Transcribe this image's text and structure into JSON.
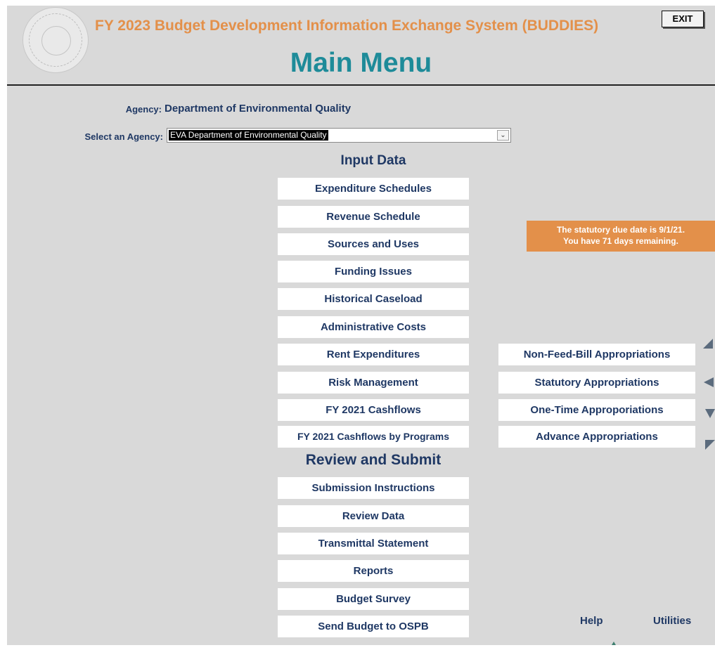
{
  "header": {
    "app_title": "FY 2023 Budget Development Information Exchange System (BUDDIES)",
    "main_title": "Main Menu",
    "exit_label": "EXIT"
  },
  "agency": {
    "label": "Agency:",
    "value": "Department of Environmental Quality",
    "select_label": "Select an Agency:",
    "select_value": "EVA Department of Environmental Quality",
    "select_arrow_icon": "chevron-down-icon"
  },
  "input_data": {
    "title": "Input Data",
    "buttons": [
      "Expenditure Schedules",
      "Revenue Schedule",
      "Sources and Uses",
      "Funding Issues",
      "Historical Caseload",
      "Administrative Costs",
      "Rent Expenditures",
      "Risk Management",
      "FY 2021 Cashflows",
      "FY 2021 Cashflows by Programs"
    ]
  },
  "review_submit": {
    "title": "Review and Submit",
    "buttons": [
      "Submission Instructions",
      "Review Data",
      "Transmittal Statement",
      "Reports",
      "Budget Survey",
      "Send Budget to OSPB"
    ]
  },
  "appropriations": {
    "buttons": [
      "Non-Feed-Bill Appropriations",
      "Statutory Appropriations",
      "One-Time Approporiations",
      "Advance Appropriations"
    ]
  },
  "due_notice": {
    "line1": "The statutory due date is 9/1/21.",
    "line2": "You have 71 days remaining."
  },
  "footer": {
    "help_label": "Help",
    "utilities_label": "Utilities"
  },
  "colors": {
    "background": "#d9d9d9",
    "title_orange": "#e3904a",
    "main_title_teal": "#1e8b99",
    "navy_text": "#1f3864",
    "arrow_teal": "#5b6b7d"
  }
}
